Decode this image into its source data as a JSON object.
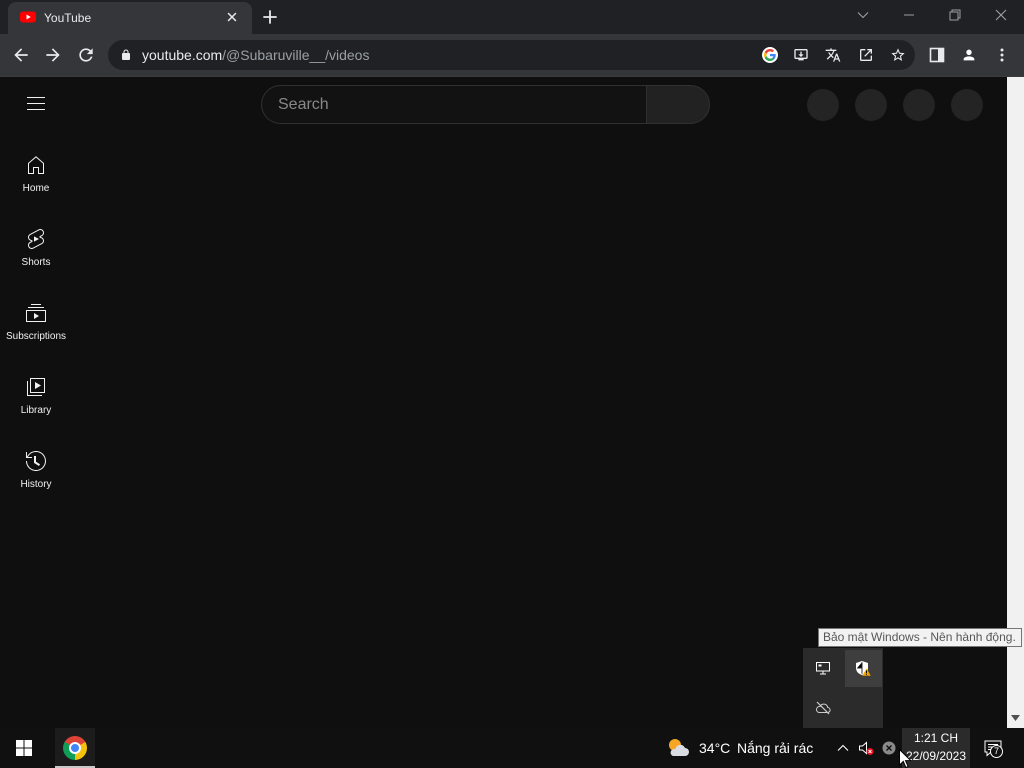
{
  "browser": {
    "tab_title": "YouTube",
    "url": {
      "host": "youtube.com",
      "path": "/@Subaruville__/videos"
    },
    "omnibox_icons": [
      "google-lens-icon",
      "install-app-icon",
      "translate-icon",
      "share-icon",
      "bookmark-star-icon"
    ],
    "toolbar_icons": [
      "side-panel-icon",
      "profile-icon",
      "menu-dots-icon"
    ]
  },
  "youtube": {
    "search": {
      "placeholder": "Search"
    },
    "nav": [
      {
        "label": "Home",
        "icon": "home-icon"
      },
      {
        "label": "Shorts",
        "icon": "shorts-icon"
      },
      {
        "label": "Subscriptions",
        "icon": "subscriptions-icon"
      },
      {
        "label": "Library",
        "icon": "library-icon"
      },
      {
        "label": "History",
        "icon": "history-icon"
      }
    ]
  },
  "tooltip": {
    "text": "Bảo mật Windows - Nên hành động."
  },
  "tray_overflow": {
    "icons": [
      "display-icon",
      "windows-security-warning-icon",
      "onedrive-offline-icon"
    ]
  },
  "taskbar": {
    "pinned": [
      "windows-start-icon",
      "chrome-icon"
    ],
    "weather": {
      "icon": "partly-sunny-icon",
      "temperature": "34°C",
      "condition": "Nắng rải rác"
    },
    "tray_icons": [
      "chevron-up-icon",
      "volume-muted-icon",
      "network-disconnected-icon"
    ],
    "clock": {
      "time": "1:21 CH",
      "date": "22/09/2023"
    },
    "notifications_count": "7"
  },
  "colors": {
    "youtube_red": "#ff0000",
    "page_background": "#0f0f0f",
    "chrome_toolbar": "#35363a",
    "warning_orange": "#f7a600",
    "muted_red": "#e81123"
  }
}
